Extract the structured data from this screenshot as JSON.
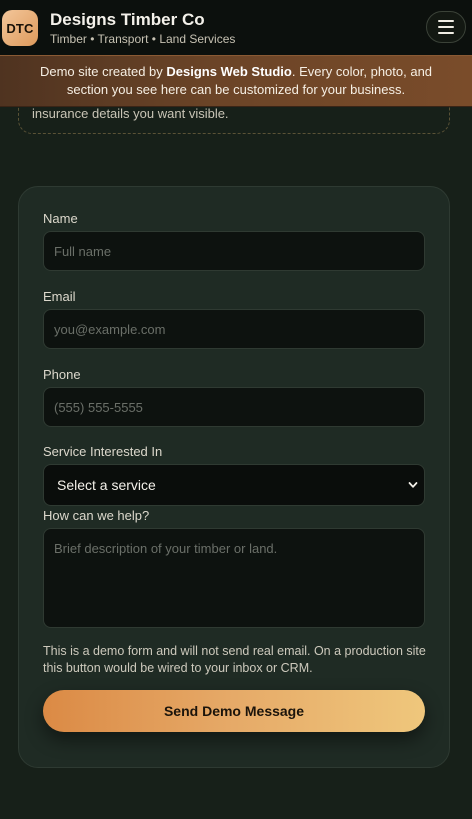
{
  "header": {
    "logo_text": "DTC",
    "brand_name": "Designs Timber Co",
    "tagline": "Timber • Transport • Land Services",
    "menu_icon": "hamburger-icon"
  },
  "banner": {
    "prefix": "Demo site created by ",
    "studio": "Designs Web Studio",
    "suffix": ". Every color, photo, and section you see here can be customized for your business."
  },
  "previous_section": {
    "text": "insurance details you want visible."
  },
  "form": {
    "name_label": "Name",
    "name_placeholder": "Full name",
    "email_label": "Email",
    "email_placeholder": "you@example.com",
    "phone_label": "Phone",
    "phone_placeholder": "(555) 555-5555",
    "service_label": "Service Interested In",
    "service_selected": "Select a service",
    "message_label": "How can we help?",
    "message_placeholder": "Brief description of your timber or land.",
    "note": "This is a demo form and will not send real email. On a production site this button would be wired to your inbox or CRM.",
    "submit_label": "Send Demo Message"
  },
  "colors": {
    "accent": "#e6aa68",
    "background": "#172019",
    "card": "#1f2b24"
  }
}
